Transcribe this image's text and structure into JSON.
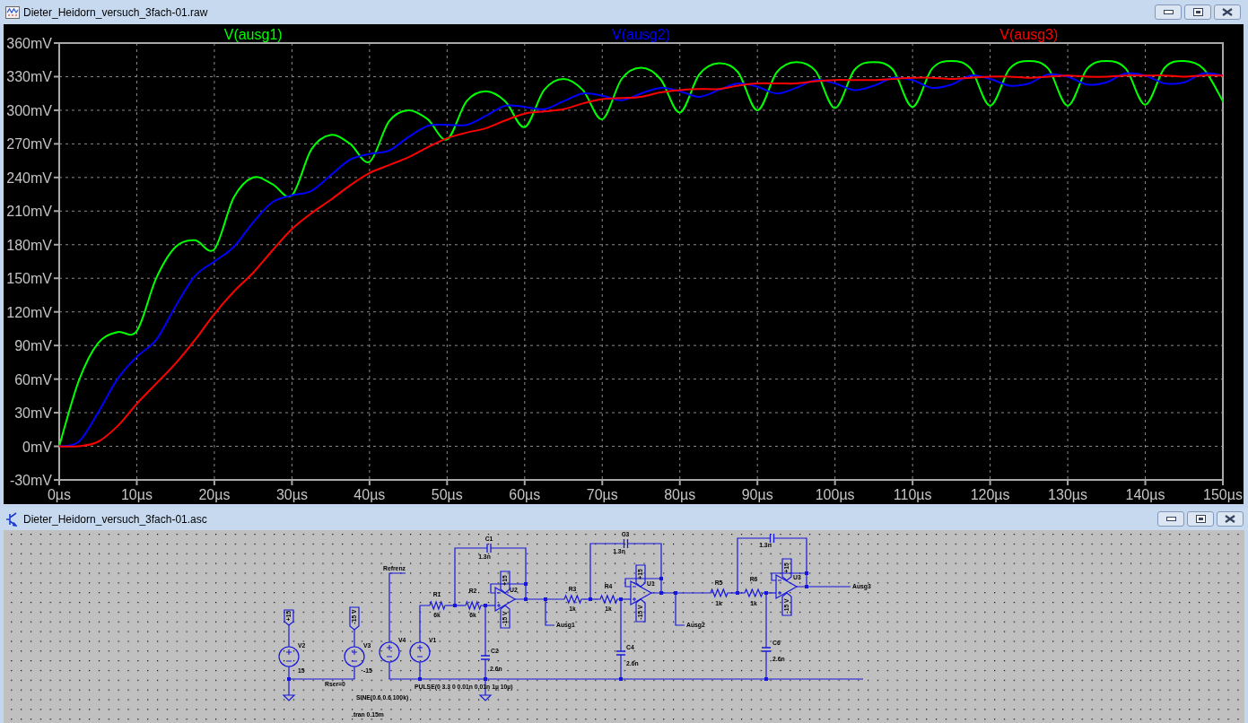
{
  "waveform_window": {
    "title": "Dieter_Heidorn_versuch_3fach-01.raw",
    "graph": {
      "chart_data": {
        "type": "line",
        "grid": true,
        "x": [
          0,
          2.5,
          5,
          7.5,
          10,
          12.5,
          15,
          17.5,
          20,
          22.5,
          25,
          27.5,
          30,
          32.5,
          35,
          37.5,
          40,
          42.5,
          45,
          47.5,
          50,
          52.5,
          55,
          57.5,
          60,
          62.5,
          65,
          67.5,
          70,
          72.5,
          75,
          77.5,
          80,
          82.5,
          85,
          87.5,
          90,
          92.5,
          95,
          97.5,
          100,
          102.5,
          105,
          107.5,
          110,
          112.5,
          115,
          117.5,
          120,
          122.5,
          125,
          127.5,
          130,
          132.5,
          135,
          137.5,
          140,
          142.5,
          145,
          147.5,
          150
        ],
        "series": [
          {
            "name": "V(ausg1)",
            "color": "#00ff00",
            "values": [
              0,
              58,
              92,
              102,
              103,
              150,
              178,
              184,
              176,
              222,
              240,
              234,
              224,
              265,
              278,
              270,
              254,
              290,
              300,
              292,
              274,
              308,
              317,
              308,
              285,
              318,
              328,
              318,
              292,
              328,
              338,
              328,
              298,
              332,
              342,
              334,
              300,
              334,
              343,
              335,
              302,
              336,
              343,
              336,
              303,
              337,
              344,
              337,
              304,
              337,
              344,
              337,
              304,
              337,
              344,
              337,
              305,
              338,
              344,
              337,
              308
            ]
          },
          {
            "name": "V(ausg2)",
            "color": "#0000ff",
            "values": [
              0,
              4,
              30,
              60,
              80,
              95,
              125,
              152,
              165,
              178,
              200,
              218,
              224,
              228,
              242,
              256,
              261,
              264,
              276,
              286,
              287,
              287,
              295,
              304,
              303,
              301,
              308,
              315,
              313,
              309,
              315,
              320,
              317,
              312,
              318,
              324,
              321,
              315,
              320,
              327,
              324,
              318,
              322,
              329,
              327,
              320,
              323,
              331,
              328,
              322,
              324,
              332,
              330,
              323,
              325,
              333,
              331,
              324,
              325,
              333,
              331
            ]
          },
          {
            "name": "V(ausg3)",
            "color": "#ff0000",
            "values": [
              0,
              0,
              4,
              18,
              38,
              56,
              74,
              95,
              118,
              138,
              155,
              175,
              194,
              208,
              220,
              233,
              244,
              251,
              258,
              267,
              275,
              280,
              284,
              291,
              297,
              299,
              301,
              306,
              310,
              311,
              312,
              316,
              318,
              319,
              319,
              322,
              324,
              324,
              324,
              326,
              327,
              327,
              327,
              328,
              329,
              329,
              328,
              329,
              330,
              330,
              329,
              330,
              331,
              330,
              330,
              331,
              331,
              331,
              330,
              331,
              331
            ]
          }
        ],
        "xlim": [
          0,
          150
        ],
        "ylim": [
          -30,
          360
        ],
        "xticks": [
          {
            "value": 0,
            "label": "0µs"
          },
          {
            "value": 10,
            "label": "10µs"
          },
          {
            "value": 20,
            "label": "20µs"
          },
          {
            "value": 30,
            "label": "30µs"
          },
          {
            "value": 40,
            "label": "40µs"
          },
          {
            "value": 50,
            "label": "50µs"
          },
          {
            "value": 60,
            "label": "60µs"
          },
          {
            "value": 70,
            "label": "70µs"
          },
          {
            "value": 80,
            "label": "80µs"
          },
          {
            "value": 90,
            "label": "90µs"
          },
          {
            "value": 100,
            "label": "100µs"
          },
          {
            "value": 110,
            "label": "110µs"
          },
          {
            "value": 120,
            "label": "120µs"
          },
          {
            "value": 130,
            "label": "130µs"
          },
          {
            "value": 140,
            "label": "140µs"
          },
          {
            "value": 150,
            "label": "150µs"
          }
        ],
        "yticks": [
          {
            "value": -30,
            "label": "-30mV"
          },
          {
            "value": 0,
            "label": "0mV"
          },
          {
            "value": 30,
            "label": "30mV"
          },
          {
            "value": 60,
            "label": "60mV"
          },
          {
            "value": 90,
            "label": "90mV"
          },
          {
            "value": 120,
            "label": "120mV"
          },
          {
            "value": 150,
            "label": "150mV"
          },
          {
            "value": 180,
            "label": "180mV"
          },
          {
            "value": 210,
            "label": "210mV"
          },
          {
            "value": 240,
            "label": "240mV"
          },
          {
            "value": 270,
            "label": "270mV"
          },
          {
            "value": 300,
            "label": "300mV"
          },
          {
            "value": 330,
            "label": "330mV"
          },
          {
            "value": 360,
            "label": "360mV"
          }
        ]
      }
    }
  },
  "schematic_window": {
    "title": "Dieter_Heidorn_versuch_3fach-01.asc",
    "components": [
      {
        "kind": "voltage_source",
        "name": "V2",
        "value": "15"
      },
      {
        "kind": "voltage_source",
        "name": "V3",
        "value": "-15"
      },
      {
        "kind": "voltage_source",
        "name": "V4"
      },
      {
        "kind": "voltage_source",
        "name": "V1"
      },
      {
        "kind": "resistor",
        "name": "R1",
        "value": "6k"
      },
      {
        "kind": "resistor",
        "name": "R2",
        "value": "6k"
      },
      {
        "kind": "capacitor",
        "name": "C1",
        "value": "1.3n"
      },
      {
        "kind": "capacitor",
        "name": "C2",
        "value": "2.6n"
      },
      {
        "kind": "opamp",
        "name": "U2"
      },
      {
        "kind": "resistor",
        "name": "R3",
        "value": "1k"
      },
      {
        "kind": "resistor",
        "name": "R4",
        "value": "1k"
      },
      {
        "kind": "capacitor",
        "name": "C3",
        "value": "1.3n"
      },
      {
        "kind": "capacitor",
        "name": "C4",
        "value": "2.6n"
      },
      {
        "kind": "opamp",
        "name": "U1"
      },
      {
        "kind": "resistor",
        "name": "R5",
        "value": "1k"
      },
      {
        "kind": "resistor",
        "name": "R6",
        "value": "1k"
      },
      {
        "kind": "capacitor",
        "value": "1.3n"
      },
      {
        "kind": "capacitor",
        "name": "C6",
        "value": "2.6n"
      },
      {
        "kind": "opamp",
        "name": "U3"
      }
    ],
    "power_flags": [
      "+15",
      "-15 V",
      "+15",
      "-15 V",
      "+15",
      "-15 V",
      "+15",
      "-15 V"
    ],
    "net_labels": [
      "Refrenz",
      "Ausg1",
      "Ausg2",
      "Ausg3"
    ],
    "annotations": [
      "Rser=0",
      "SINE(0.6 0.6 100k)",
      "PULSE(0 3.3 0 0.01n 0.01n 1µ 10µ)",
      ".tran 0.15m"
    ]
  }
}
